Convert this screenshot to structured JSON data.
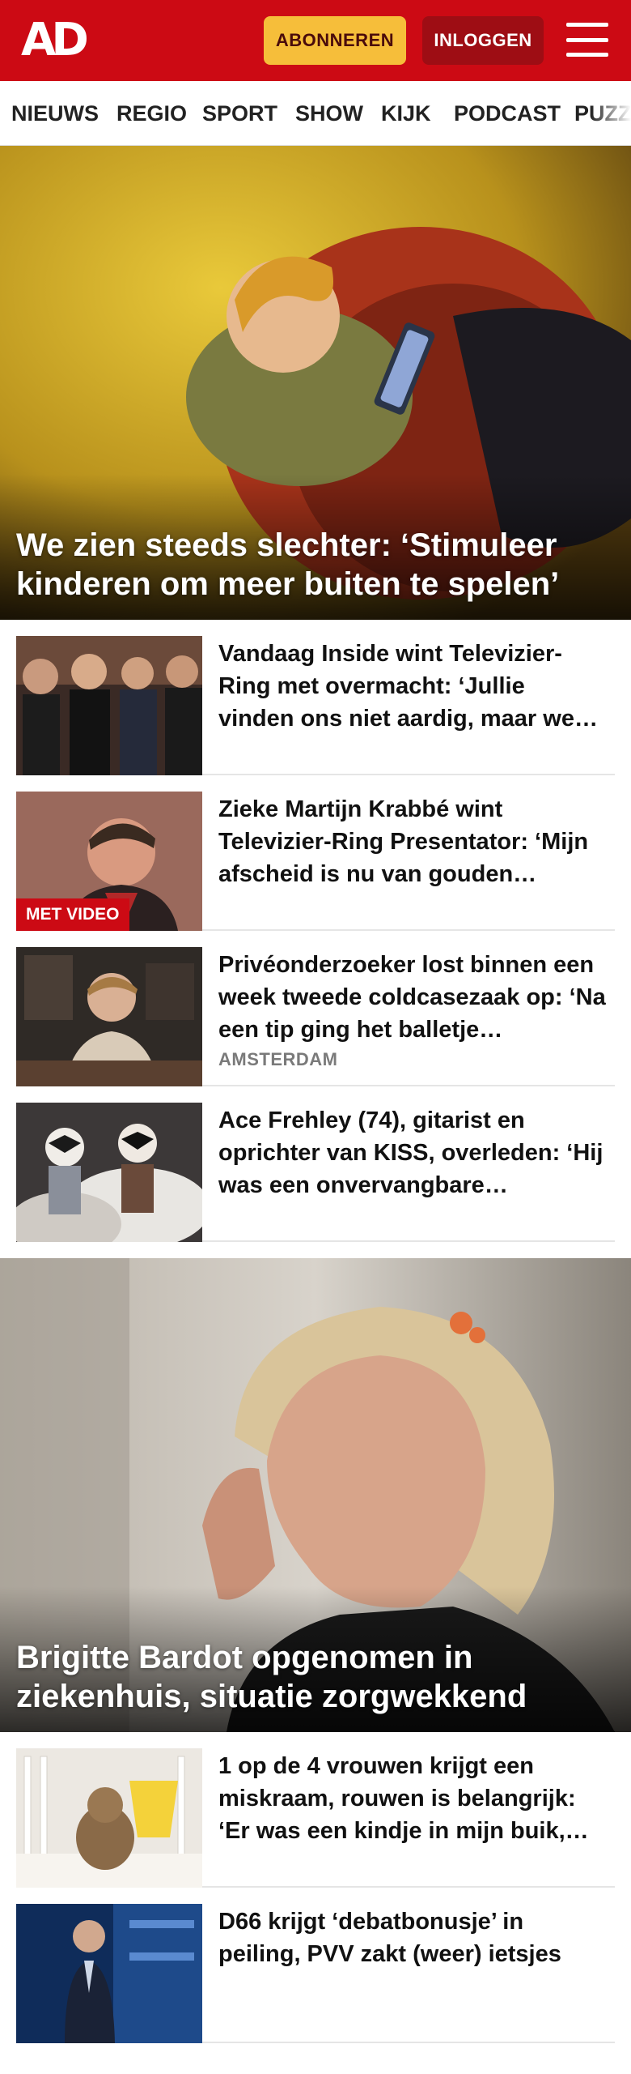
{
  "header": {
    "logo": "AD",
    "subscribe_label": "ABONNEREN",
    "login_label": "INLOGGEN",
    "menu_icon": "hamburger-menu-icon",
    "brand_color": "#cc0a14",
    "accent_color": "#f6be3a"
  },
  "nav": {
    "items": [
      "NIEUWS",
      "REGIO",
      "SPORT",
      "SHOW",
      "KIJK",
      "PODCAST",
      "PUZZ"
    ]
  },
  "hero1": {
    "title": "We zien steeds slechter: ‘Stimuleer kinderen om meer buiten te spelen’"
  },
  "list1": [
    {
      "title": "Vandaag Inside wint Televizier-Ring met overmacht: ‘Jullie vinden ons niet aardig, maar we…",
      "badge": "",
      "location": ""
    },
    {
      "title": "Zieke Martijn Krabbé wint Televizier-Ring Presentator: ‘Mijn afscheid is nu van gouden…",
      "badge": "MET VIDEO",
      "location": ""
    },
    {
      "title": "Privéonderzoeker lost binnen een week tweede coldcasezaak op: ‘Na een tip ging het balletje…",
      "badge": "",
      "location": "AMSTERDAM"
    },
    {
      "title": "Ace Frehley (74), gitarist en oprichter van KISS, overleden: ‘Hij was een onvervangbare…",
      "badge": "",
      "location": ""
    }
  ],
  "hero2": {
    "title": "Brigitte Bardot opgenomen in ziekenhuis, situatie zorgwekkend"
  },
  "list2": [
    {
      "title": "1 op de 4 vrouwen krijgt een miskraam, rouwen is belangrijk: ‘Er was een kindje in mijn buik,…",
      "badge": "",
      "location": ""
    },
    {
      "title": "D66 krijgt ‘debatbonusje’ in peiling, PVV zakt (weer) ietsjes",
      "badge": "",
      "location": ""
    }
  ]
}
